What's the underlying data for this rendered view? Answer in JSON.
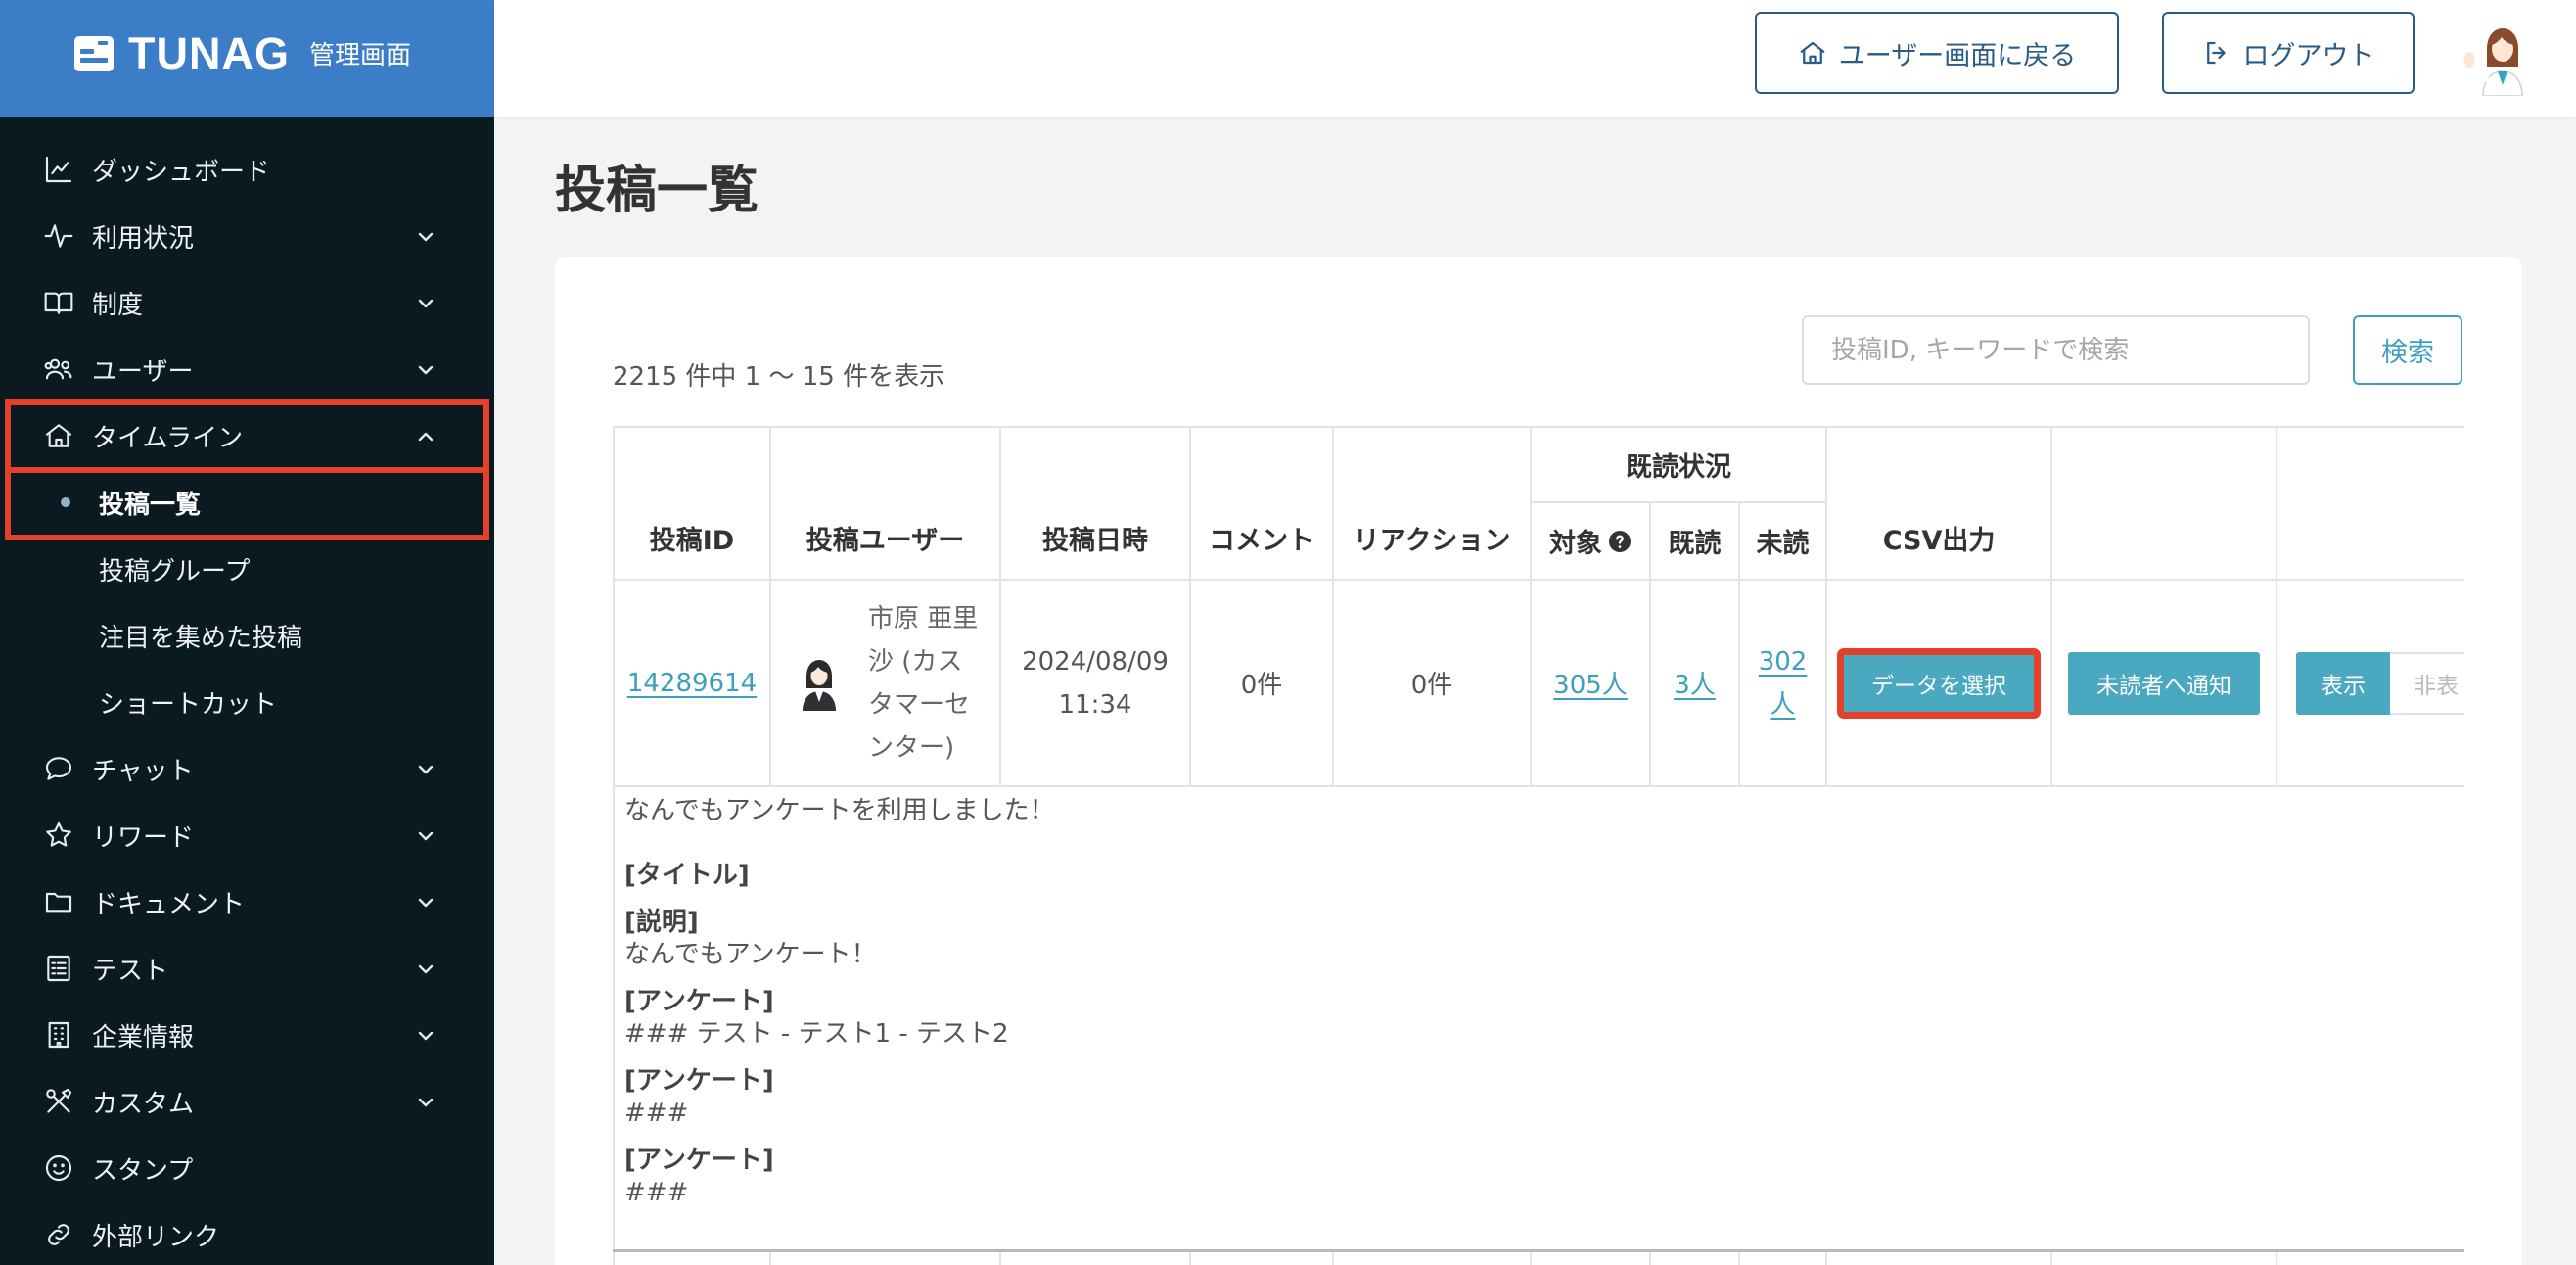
{
  "app": {
    "brand": "TUNAG",
    "brand_sub": "管理画面"
  },
  "header": {
    "back_label": "ユーザー画面に戻る",
    "logout_label": "ログアウト"
  },
  "sidebar": {
    "items": [
      {
        "label": "ダッシュボード",
        "icon": "chart-icon"
      },
      {
        "label": "利用状況",
        "icon": "activity-icon",
        "expandable": true
      },
      {
        "label": "制度",
        "icon": "book-icon",
        "expandable": true
      },
      {
        "label": "ユーザー",
        "icon": "users-icon",
        "expandable": true
      },
      {
        "label": "タイムライン",
        "icon": "home-icon",
        "expandable": true,
        "expanded": true
      },
      {
        "label": "チャット",
        "icon": "chat-icon",
        "expandable": true
      },
      {
        "label": "リワード",
        "icon": "star-icon",
        "expandable": true
      },
      {
        "label": "ドキュメント",
        "icon": "folder-icon",
        "expandable": true
      },
      {
        "label": "テスト",
        "icon": "checklist-icon",
        "expandable": true
      },
      {
        "label": "企業情報",
        "icon": "building-icon",
        "expandable": true
      },
      {
        "label": "カスタム",
        "icon": "tools-icon",
        "expandable": true
      },
      {
        "label": "スタンプ",
        "icon": "smiley-icon"
      },
      {
        "label": "外部リンク",
        "icon": "link-icon"
      }
    ],
    "timeline_sub": [
      {
        "label": "投稿一覧",
        "active": true
      },
      {
        "label": "投稿グループ"
      },
      {
        "label": "注目を集めた投稿"
      },
      {
        "label": "ショートカット"
      }
    ]
  },
  "page": {
    "title": "投稿一覧"
  },
  "search": {
    "placeholder": "投稿ID, キーワードで検索",
    "button": "検索"
  },
  "summary": "2215 件中 1 〜 15 件を表示",
  "table": {
    "headers": {
      "post_id": "投稿ID",
      "user": "投稿ユーザー",
      "date": "投稿日時",
      "comment": "コメント",
      "reaction": "リアクション",
      "read_status": "既読状況",
      "target": "対象",
      "read": "既読",
      "unread": "未読",
      "csv": "CSV出力"
    },
    "rows": [
      {
        "post_id": "14289614",
        "user_name": "市原 亜里沙 (カスタマーセンター)",
        "date": "2024/08/09 11:34",
        "comments": "0件",
        "reactions": "0件",
        "target": "305人",
        "read": "3人",
        "unread": "302人",
        "csv_button": "データを選択",
        "notify_button": "未読者へ通知",
        "show_button": "表示",
        "hide_button": "非表",
        "description": {
          "intro": "なんでもアンケートを利用しました！",
          "sections": [
            {
              "heading": "[タイトル]",
              "body": ""
            },
            {
              "heading": "[説明]",
              "body": "なんでもアンケート！"
            },
            {
              "heading": "[アンケート]",
              "body": "### テスト - テスト1 - テスト2"
            },
            {
              "heading": "[アンケート]",
              "body": "###"
            },
            {
              "heading": "[アンケート]",
              "body": "###"
            }
          ]
        }
      }
    ]
  },
  "colors": {
    "brand_blue": "#3b7ec7",
    "sidebar_bg": "#0b1a20",
    "accent_teal": "#4ba8c1",
    "link": "#3d9fbe",
    "annotation_red": "#e5402a"
  }
}
